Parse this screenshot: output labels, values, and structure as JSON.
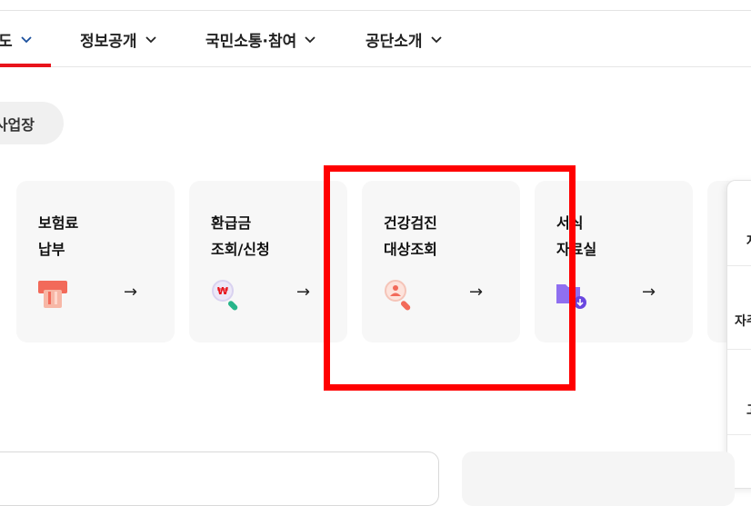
{
  "nav": {
    "items": [
      {
        "label": "도"
      },
      {
        "label": "정보공개"
      },
      {
        "label": "국민소통·참여"
      },
      {
        "label": "공단소개"
      }
    ]
  },
  "pill": {
    "label": "사업장"
  },
  "cards": [
    {
      "line1": "보험료",
      "line2": "납부",
      "icon": "payment-card-icon",
      "arrow": "→"
    },
    {
      "line1": "환급금",
      "line2": "조회/신청",
      "icon": "refund-search-icon",
      "arrow": "→"
    },
    {
      "line1": "건강검진",
      "line2": "대상조회",
      "icon": "checkup-search-icon",
      "arrow": "→"
    },
    {
      "line1": "서식",
      "line2": "자료실",
      "icon": "form-download-icon",
      "arrow": "→"
    }
  ],
  "side_panel": {
    "labels": [
      "자",
      "자주",
      "고"
    ]
  },
  "colors": {
    "accent_red": "#e8141b",
    "card_bg": "#f7f7f7",
    "highlight_box": "#ff0000"
  }
}
